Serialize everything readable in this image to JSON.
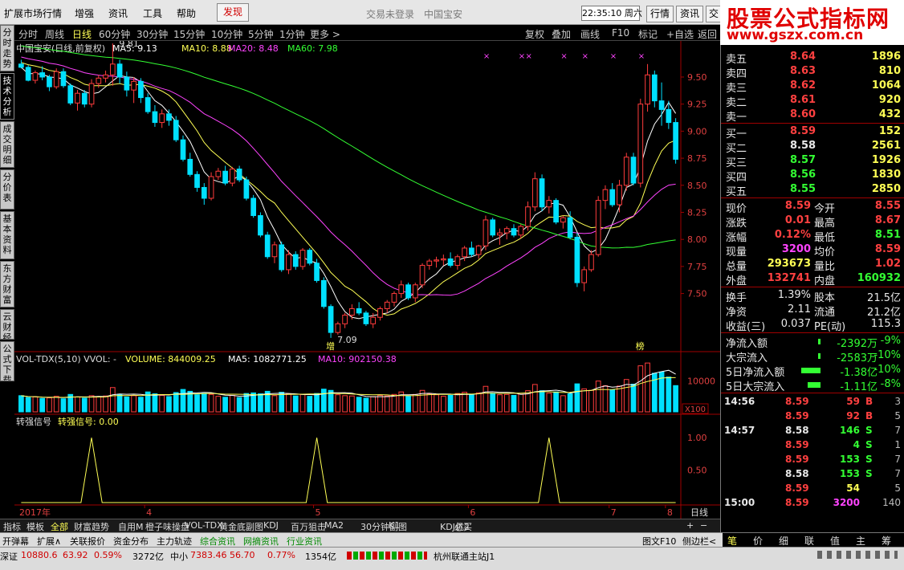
{
  "menu": {
    "items": [
      "扩展市场行情",
      "增强",
      "资讯",
      "工具",
      "帮助"
    ],
    "hot": "发现",
    "login_status": "交易未登录",
    "stock_title": "中国宝安",
    "clock": "22:35:10 周六",
    "right_buttons": [
      "行情",
      "资讯",
      "交"
    ]
  },
  "logo": {
    "line1": "股票公式指标网",
    "line2": "www.gszx.com.cn"
  },
  "side_tabs": [
    {
      "label": "分时走势",
      "active": false
    },
    {
      "label": "技术分析",
      "active": true
    },
    {
      "label": "成交明细",
      "active": false
    },
    {
      "label": "分价表",
      "active": false
    },
    {
      "label": "基本资料",
      "active": false
    },
    {
      "label": "东方财富",
      "active": false
    },
    {
      "label": "云财经",
      "active": false
    },
    {
      "label": "公式下载",
      "active": false
    }
  ],
  "periods": [
    "分时",
    "周线",
    "日线",
    "60分钟",
    "30分钟",
    "15分钟",
    "10分钟",
    "5分钟",
    "1分钟",
    "更多 >"
  ],
  "selected_period": "日线",
  "chart_tools": [
    "复权",
    "叠加",
    "画线",
    "F10",
    "标记",
    "+自选",
    "返回"
  ],
  "indicator_tabs": [
    "指标",
    "模板",
    "全部",
    "财富趋势",
    "自用M",
    "橙子味操盘",
    "VOL-TDX",
    "黄金底副图",
    "KDJ",
    "百万狙击",
    "MA2",
    "30分钟副图",
    "K1",
    "KDJ优2",
    "必买"
  ],
  "selected_indicator_tab": "全部",
  "toolbar": {
    "left": [
      "开弹幕",
      "扩展∧",
      "关联报价",
      "资金分布",
      "主力轨迹"
    ],
    "news": [
      "综合资讯",
      "网摘资讯",
      "行业资讯"
    ],
    "right": [
      "图文F10",
      "侧边栏<"
    ]
  },
  "status": {
    "sz_label": "深证",
    "sz_value": "10880.6",
    "sz_change": "63.92",
    "sz_pct": "0.59%",
    "sz_amount": "3272亿",
    "zx_label": "中小",
    "zx_value": "7383.46",
    "zx_change": "56.70",
    "zx_pct": "0.77%",
    "zx_amount": "1354亿",
    "server": "杭州联通主站J1"
  },
  "quote": {
    "asks": [
      {
        "label": "卖五",
        "price": "8.64",
        "vol": "1896"
      },
      {
        "label": "卖四",
        "price": "8.63",
        "vol": "810"
      },
      {
        "label": "卖三",
        "price": "8.62",
        "vol": "1064"
      },
      {
        "label": "卖二",
        "price": "8.61",
        "vol": "920"
      },
      {
        "label": "卖一",
        "price": "8.60",
        "vol": "432"
      }
    ],
    "bids": [
      {
        "label": "买一",
        "price": "8.59",
        "vol": "152"
      },
      {
        "label": "买二",
        "price": "8.58",
        "vol": "2561"
      },
      {
        "label": "买三",
        "price": "8.57",
        "vol": "1926"
      },
      {
        "label": "买四",
        "price": "8.56",
        "vol": "1830"
      },
      {
        "label": "买五",
        "price": "8.55",
        "vol": "2850"
      }
    ],
    "stats": [
      {
        "l1": "现价",
        "v1": "8.59",
        "l2": "今开",
        "v2": "8.55"
      },
      {
        "l1": "涨跌",
        "v1": "0.01",
        "l2": "最高",
        "v2": "8.67"
      },
      {
        "l1": "涨幅",
        "v1": "0.12%",
        "l2": "最低",
        "v2": "8.51"
      },
      {
        "l1": "现量",
        "v1": "3200",
        "l2": "均价",
        "v2": "8.59"
      },
      {
        "l1": "总量",
        "v1": "293673",
        "l2": "量比",
        "v2": "1.02"
      },
      {
        "l1": "外盘",
        "v1": "132741",
        "l2": "内盘",
        "v2": "160932"
      }
    ],
    "fund": [
      {
        "l1": "换手",
        "v1": "1.39%",
        "l2": "股本",
        "v2": "21.5亿"
      },
      {
        "l1": "净资",
        "v1": "2.11",
        "l2": "流通",
        "v2": "21.2亿"
      },
      {
        "l1": "收益(三)",
        "v1": "0.037",
        "l2": "PE(动)",
        "v2": "115.3"
      }
    ],
    "flows": [
      {
        "label": "净流入额",
        "value": "-2392万",
        "pct": "-9%"
      },
      {
        "label": "大宗流入",
        "value": "-2583万",
        "pct": "-10%"
      },
      {
        "label": "5日净流入额",
        "value": "-1.38亿",
        "pct": "-10%"
      },
      {
        "label": "5日大宗流入",
        "value": "-1.11亿",
        "pct": "-8%"
      }
    ],
    "ticks": [
      {
        "time": "14:56",
        "price": "8.59",
        "vol": "59",
        "bs": "B",
        "n": "3"
      },
      {
        "time": "",
        "price": "8.59",
        "vol": "92",
        "bs": "B",
        "n": "5"
      },
      {
        "time": "14:57",
        "price": "8.58",
        "vol": "146",
        "bs": "S",
        "n": "7"
      },
      {
        "time": "",
        "price": "8.59",
        "vol": "4",
        "bs": "S",
        "n": "1"
      },
      {
        "time": "",
        "price": "8.59",
        "vol": "153",
        "bs": "S",
        "n": "7"
      },
      {
        "time": "",
        "price": "8.58",
        "vol": "153",
        "bs": "S",
        "n": "7"
      },
      {
        "time": "",
        "price": "8.59",
        "vol": "54",
        "bs": "",
        "n": "5"
      },
      {
        "time": "15:00",
        "price": "8.59",
        "vol": "3200",
        "bs": "",
        "n": "140"
      }
    ]
  },
  "right_tabs": [
    "笔",
    "价",
    "细",
    "联",
    "值",
    "主",
    "筹"
  ],
  "chart_data": [
    {
      "type": "candlestick",
      "title": "中国宝安(日线,前复权)",
      "ma_labels": [
        {
          "name": "MA5",
          "value": "9.13",
          "color": "#ffffff"
        },
        {
          "name": "MA10",
          "value": "8.88",
          "color": "#ffff55"
        },
        {
          "name": "MA20",
          "value": "8.48",
          "color": "#ff44ff"
        },
        {
          "name": "MA60",
          "value": "7.98",
          "color": "#33ff33"
        }
      ],
      "ylim": [
        7.0,
        9.7
      ],
      "y_ticks": [
        "9.50",
        "9.25",
        "9.00",
        "8.75",
        "8.50",
        "8.25",
        "8.00",
        "7.75",
        "7.50"
      ],
      "x_labels": [
        "2017年",
        "4",
        "5",
        "6",
        "7",
        "8"
      ],
      "annotations": {
        "high": "9.81",
        "low": "7.09",
        "tag1": "增",
        "tag2": "榜"
      },
      "candles": [
        [
          9.62,
          9.66,
          9.58,
          9.59
        ],
        [
          9.59,
          9.61,
          9.46,
          9.47
        ],
        [
          9.47,
          9.56,
          9.44,
          9.54
        ],
        [
          9.54,
          9.6,
          9.47,
          9.5
        ],
        [
          9.5,
          9.52,
          9.37,
          9.41
        ],
        [
          9.41,
          9.58,
          9.39,
          9.55
        ],
        [
          9.55,
          9.58,
          9.4,
          9.42
        ],
        [
          9.42,
          9.44,
          9.24,
          9.26
        ],
        [
          9.26,
          9.38,
          9.19,
          9.35
        ],
        [
          9.35,
          9.38,
          9.22,
          9.25
        ],
        [
          9.25,
          9.48,
          9.22,
          9.44
        ],
        [
          9.44,
          9.52,
          9.4,
          9.49
        ],
        [
          9.49,
          9.56,
          9.45,
          9.52
        ],
        [
          9.52,
          9.81,
          9.42,
          9.62
        ],
        [
          9.62,
          9.66,
          9.44,
          9.5
        ],
        [
          9.5,
          9.55,
          9.32,
          9.38
        ],
        [
          9.38,
          9.5,
          9.26,
          9.46
        ],
        [
          9.46,
          9.49,
          9.26,
          9.31
        ],
        [
          9.31,
          9.35,
          9.16,
          9.18
        ],
        [
          9.18,
          9.24,
          9.04,
          9.08
        ],
        [
          9.08,
          9.2,
          9.03,
          9.16
        ],
        [
          9.16,
          9.2,
          9.05,
          9.1
        ],
        [
          9.1,
          9.14,
          8.9,
          8.92
        ],
        [
          8.92,
          8.96,
          8.72,
          8.74
        ],
        [
          8.74,
          8.8,
          8.58,
          8.6
        ],
        [
          8.6,
          8.63,
          8.44,
          8.48
        ],
        [
          8.48,
          8.52,
          8.32,
          8.38
        ],
        [
          8.38,
          8.62,
          8.36,
          8.58
        ],
        [
          8.58,
          8.66,
          8.55,
          8.63
        ],
        [
          8.63,
          8.68,
          8.5,
          8.52
        ],
        [
          8.52,
          8.67,
          8.49,
          8.65
        ],
        [
          8.65,
          8.68,
          8.53,
          8.55
        ],
        [
          8.55,
          8.58,
          8.36,
          8.38
        ],
        [
          8.38,
          8.41,
          8.2,
          8.22
        ],
        [
          8.22,
          8.25,
          8.02,
          8.04
        ],
        [
          8.04,
          8.07,
          7.82,
          7.84
        ],
        [
          7.84,
          7.98,
          7.78,
          7.95
        ],
        [
          7.95,
          7.98,
          7.7,
          7.72
        ],
        [
          7.72,
          7.9,
          7.68,
          7.86
        ],
        [
          7.86,
          7.89,
          7.72,
          7.75
        ],
        [
          7.75,
          7.92,
          7.72,
          7.9
        ],
        [
          7.9,
          7.92,
          7.76,
          7.78
        ],
        [
          7.78,
          7.82,
          7.6,
          7.62
        ],
        [
          7.62,
          7.65,
          7.36,
          7.38
        ],
        [
          7.38,
          7.4,
          7.09,
          7.14
        ],
        [
          7.14,
          7.24,
          7.12,
          7.22
        ],
        [
          7.22,
          7.32,
          7.18,
          7.3
        ],
        [
          7.3,
          7.4,
          7.26,
          7.36
        ],
        [
          7.36,
          7.42,
          7.3,
          7.32
        ],
        [
          7.32,
          7.34,
          7.2,
          7.22
        ],
        [
          7.22,
          7.32,
          7.18,
          7.28
        ],
        [
          7.28,
          7.38,
          7.25,
          7.36
        ],
        [
          7.36,
          7.44,
          7.32,
          7.42
        ],
        [
          7.42,
          7.52,
          7.38,
          7.5
        ],
        [
          7.5,
          7.62,
          7.46,
          7.58
        ],
        [
          7.58,
          7.6,
          7.44,
          7.46
        ],
        [
          7.46,
          7.6,
          7.42,
          7.58
        ],
        [
          7.58,
          7.78,
          7.55,
          7.76
        ],
        [
          7.76,
          7.82,
          7.72,
          7.8
        ],
        [
          7.8,
          7.84,
          7.74,
          7.81
        ],
        [
          7.81,
          7.86,
          7.76,
          7.82
        ],
        [
          7.82,
          7.88,
          7.74,
          7.76
        ],
        [
          7.76,
          7.86,
          7.72,
          7.84
        ],
        [
          7.84,
          7.94,
          7.8,
          7.92
        ],
        [
          7.92,
          7.98,
          7.84,
          7.86
        ],
        [
          7.86,
          7.95,
          7.82,
          7.94
        ],
        [
          7.94,
          8.22,
          7.9,
          8.18
        ],
        [
          8.18,
          8.2,
          8.02,
          8.04
        ],
        [
          8.04,
          8.1,
          7.95,
          8.06
        ],
        [
          8.06,
          8.12,
          8.0,
          8.1
        ],
        [
          8.1,
          8.14,
          8.02,
          8.04
        ],
        [
          8.04,
          8.14,
          8.01,
          8.12
        ],
        [
          8.12,
          8.35,
          8.08,
          8.3
        ],
        [
          8.3,
          8.62,
          8.26,
          8.56
        ],
        [
          8.56,
          8.6,
          8.26,
          8.3
        ],
        [
          8.3,
          8.4,
          8.24,
          8.36
        ],
        [
          8.36,
          8.38,
          8.14,
          8.16
        ],
        [
          8.16,
          8.22,
          8.1,
          8.2
        ],
        [
          8.2,
          8.26,
          8.0,
          8.02
        ],
        [
          8.02,
          8.06,
          7.56,
          7.6
        ],
        [
          7.6,
          7.75,
          7.52,
          7.72
        ],
        [
          7.72,
          7.9,
          7.7,
          7.86
        ],
        [
          7.86,
          8.4,
          7.84,
          8.36
        ],
        [
          8.36,
          8.5,
          8.28,
          8.46
        ],
        [
          8.46,
          8.52,
          8.3,
          8.32
        ],
        [
          8.32,
          8.55,
          8.25,
          8.5
        ],
        [
          8.5,
          8.8,
          8.45,
          8.76
        ],
        [
          8.76,
          8.8,
          8.5,
          8.52
        ],
        [
          8.52,
          9.3,
          8.48,
          9.25
        ],
        [
          9.25,
          9.62,
          9.18,
          9.52
        ],
        [
          9.52,
          9.56,
          9.22,
          9.28
        ],
        [
          9.28,
          9.45,
          9.05,
          9.2
        ],
        [
          9.2,
          9.28,
          9.02,
          9.08
        ],
        [
          9.08,
          9.12,
          8.7,
          8.74
        ]
      ]
    },
    {
      "type": "bar",
      "title": "VOL-TDX(5,10) VVOL: -",
      "labels": [
        {
          "text": "VOLUME: 844009.25",
          "color": "#ffff55"
        },
        {
          "text": "MA5: 1082771.25",
          "color": "#ffffff"
        },
        {
          "text": "MA10: 902150.38",
          "color": "#ff44ff"
        }
      ],
      "y_ticks": [
        "10000"
      ],
      "unit": "X100",
      "values": [
        5200,
        4600,
        4800,
        4300,
        4500,
        5000,
        4200,
        5600,
        4800,
        4400,
        5200,
        4900,
        5100,
        7800,
        5600,
        4800,
        5200,
        4700,
        6400,
        5800,
        5300,
        4900,
        6200,
        7200,
        6600,
        5500,
        5900,
        5600,
        5000,
        4700,
        5300,
        4600,
        5900,
        6100,
        5800,
        6600,
        5200,
        6300,
        5700,
        5100,
        5600,
        5000,
        5900,
        7300,
        6900,
        5500,
        5200,
        5100,
        4700,
        4400,
        4900,
        5300,
        5100,
        5600,
        6400,
        5100,
        5600,
        6900,
        5800,
        5500,
        5000,
        5300,
        5900,
        6300,
        5600,
        6100,
        8200,
        6000,
        5500,
        5600,
        5300,
        5700,
        6800,
        8800,
        6800,
        6000,
        6400,
        5200,
        5800,
        9000,
        7400,
        6900,
        9900,
        8400,
        7100,
        8300,
        10400,
        8900,
        14800,
        15700,
        12400,
        12800,
        11200,
        8440
      ],
      "up": [
        0,
        0,
        1,
        0,
        1,
        1,
        0,
        0,
        1,
        0,
        1,
        1,
        1,
        1,
        0,
        0,
        1,
        0,
        0,
        0,
        1,
        0,
        0,
        0,
        0,
        0,
        0,
        1,
        1,
        0,
        1,
        0,
        0,
        0,
        0,
        0,
        1,
        0,
        1,
        0,
        1,
        0,
        0,
        0,
        0,
        1,
        1,
        1,
        0,
        0,
        1,
        1,
        1,
        1,
        1,
        0,
        1,
        1,
        1,
        1,
        1,
        0,
        1,
        1,
        0,
        1,
        1,
        0,
        1,
        1,
        0,
        1,
        1,
        1,
        0,
        1,
        0,
        1,
        0,
        0,
        1,
        1,
        1,
        1,
        0,
        1,
        1,
        0,
        1,
        1,
        0,
        0,
        0,
        0
      ]
    },
    {
      "type": "line",
      "title": "转强信号",
      "value_label": "转强信号: 0.00",
      "ylim": [
        0,
        1.2
      ],
      "y_ticks": [
        "1.00",
        "0.50"
      ],
      "spikes_at_candle_index": [
        10,
        42,
        75
      ],
      "period": "日线"
    }
  ]
}
